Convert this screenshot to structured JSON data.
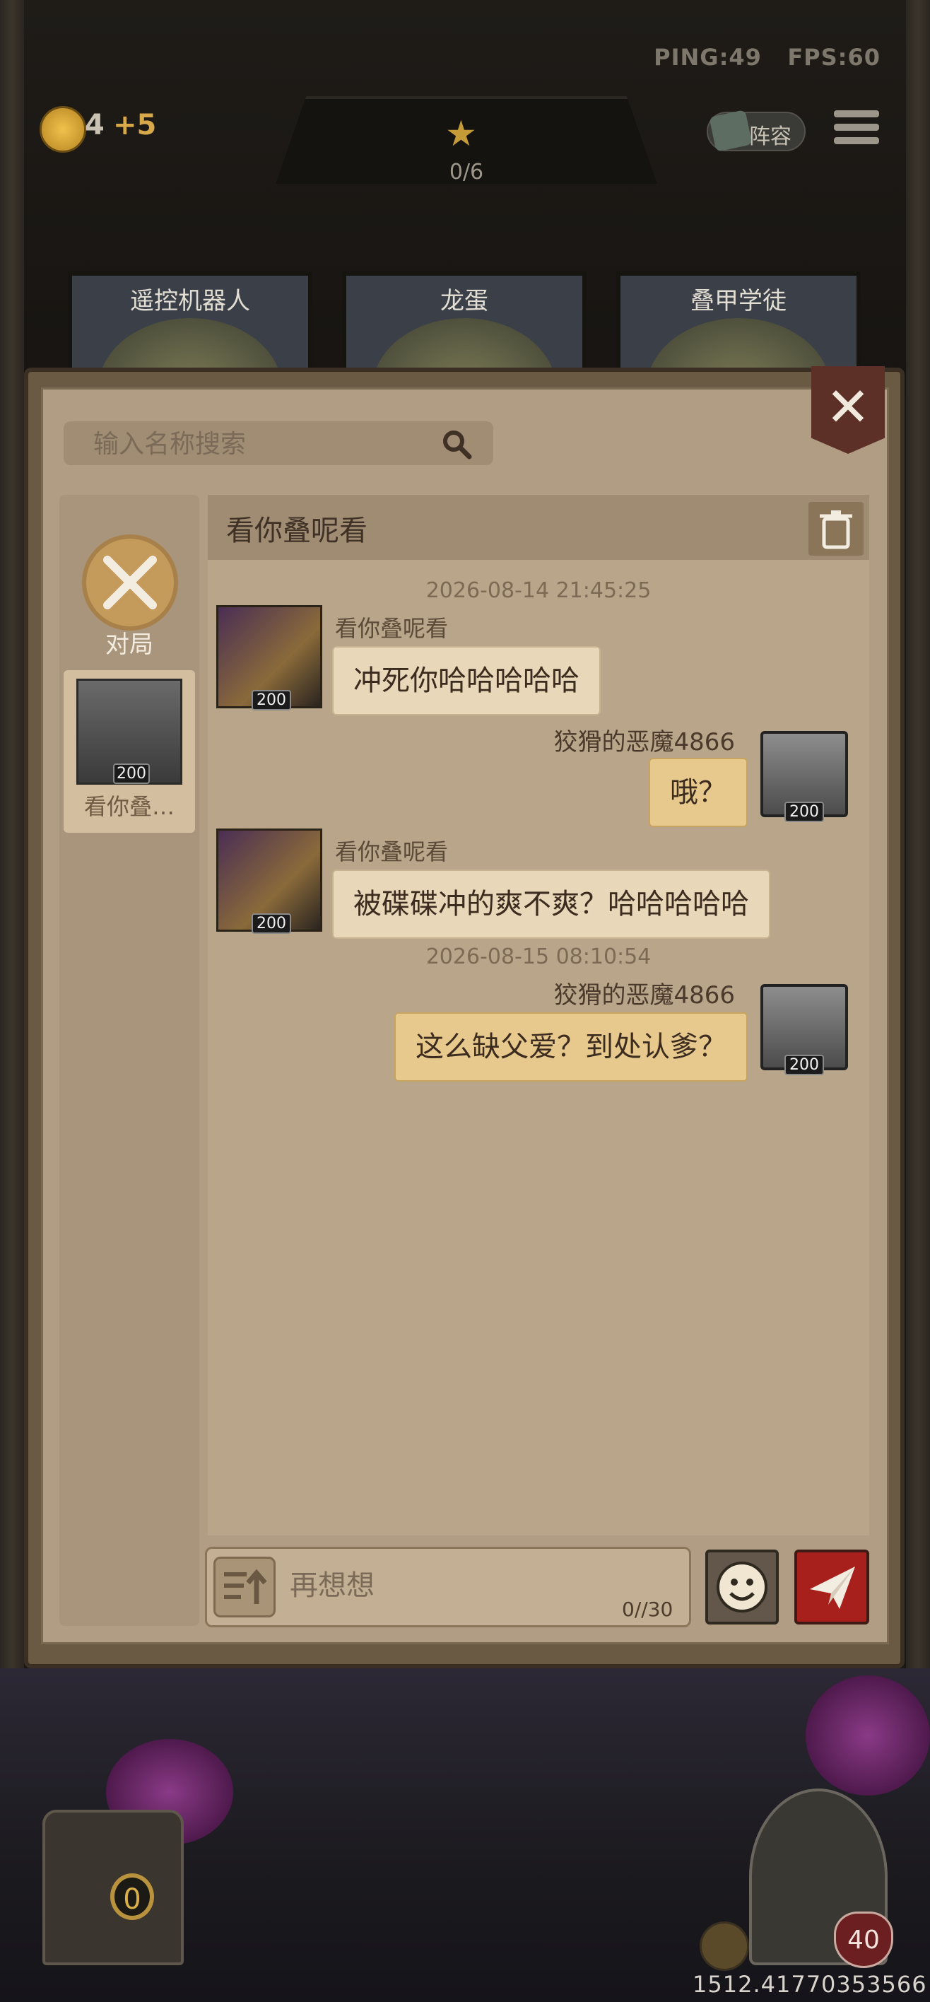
{
  "hud": {
    "ping": "PING:49",
    "fps": "FPS:60",
    "coins": "4",
    "coin_bonus": "+5",
    "star_progress": "0/6",
    "lineup_label": "阵容"
  },
  "shop_cards": [
    {
      "label": "遥控机器人"
    },
    {
      "label": "龙蛋"
    },
    {
      "label": "叠甲学徒"
    }
  ],
  "chat_panel": {
    "search_placeholder": "输入名称搜索",
    "tabs": [
      {
        "label": "对局"
      },
      {
        "label": "看你叠…",
        "level": "200"
      }
    ],
    "conversation_title": "看你叠呢看",
    "messages": [
      {
        "timestamp": "2026-08-14  21:45:25"
      },
      {
        "side": "left",
        "sender": "看你叠呢看",
        "level": "200",
        "text": "冲死你哈哈哈哈哈"
      },
      {
        "side": "right",
        "sender": "狡猾的恶魔4866",
        "level": "200",
        "text": "哦？"
      },
      {
        "side": "left",
        "sender": "看你叠呢看",
        "level": "200",
        "text": "被碟碟冲的爽不爽？哈哈哈哈哈"
      },
      {
        "timestamp": "2026-08-15  08:10:54"
      },
      {
        "side": "right",
        "sender": "狡猾的恶魔4866",
        "level": "200",
        "text": "这么缺父爱？到处认爹？"
      }
    ],
    "input_placeholder": "再想想",
    "char_counter": "0//30"
  },
  "bottom": {
    "shop_count": "0",
    "hero_hp": "40",
    "coordinates": "1512.41770353566"
  },
  "colors": {
    "panel": "#b09d83",
    "bubble_other": "#e8d7b8",
    "bubble_self": "#e7c88d",
    "send_button": "#a8201b",
    "close_button": "#5c3027"
  }
}
